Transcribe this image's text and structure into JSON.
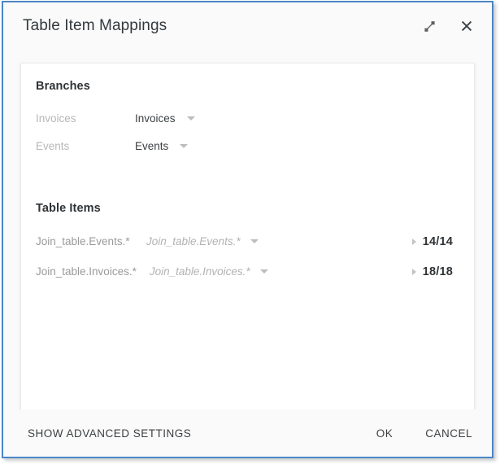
{
  "dialog": {
    "title": "Table Item Mappings",
    "accent_border_color": "#4a86c8",
    "titlebar_actions": [
      {
        "name": "expand-icon",
        "label": "Expand"
      },
      {
        "name": "close-icon",
        "label": "Close"
      }
    ]
  },
  "branches": {
    "heading": "Branches",
    "rows": [
      {
        "label": "Invoices",
        "value": "Invoices"
      },
      {
        "label": "Events",
        "value": "Events"
      }
    ]
  },
  "table_items": {
    "heading": "Table Items",
    "rows": [
      {
        "label": "Join_table.Events.*",
        "value": "Join_table.Events.*",
        "count": "14/14"
      },
      {
        "label": "Join_table.Invoices.*",
        "value": "Join_table.Invoices.*",
        "count": "18/18"
      }
    ]
  },
  "footer": {
    "advanced_label": "SHOW ADVANCED SETTINGS",
    "ok_label": "OK",
    "cancel_label": "CANCEL"
  }
}
